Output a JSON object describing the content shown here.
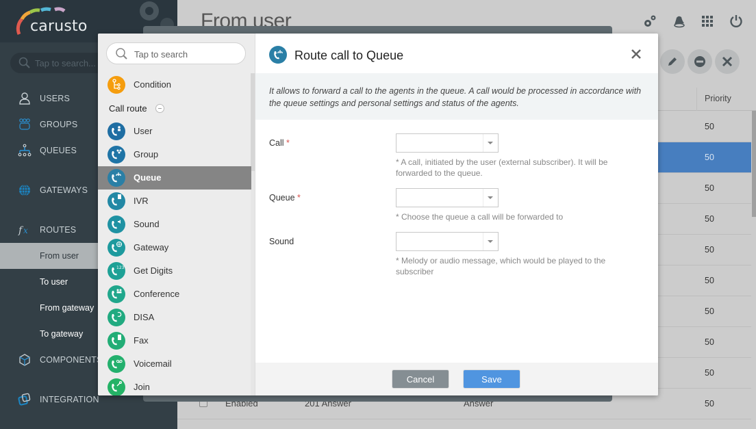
{
  "app": {
    "logo_text": "carusto"
  },
  "sidebar": {
    "search_placeholder": "Tap to search...",
    "items": [
      {
        "label": "USERS",
        "icon": "user-icon"
      },
      {
        "label": "GROUPS",
        "icon": "groups-icon"
      },
      {
        "label": "QUEUES",
        "icon": "queues-icon"
      },
      {
        "label": "GATEWAYS",
        "icon": "globe-icon"
      },
      {
        "label": "ROUTES",
        "icon": "fx-icon"
      },
      {
        "label": "COMPONENTS",
        "icon": "cube-icon"
      },
      {
        "label": "INTEGRATION",
        "icon": "integration-icon"
      }
    ],
    "route_subitems": [
      {
        "label": "From user",
        "active": true
      },
      {
        "label": "To user"
      },
      {
        "label": "From gateway"
      },
      {
        "label": "To gateway"
      }
    ]
  },
  "main": {
    "page_title": "From user",
    "top_icons": [
      "settings-icon",
      "bell-icon",
      "apps-grid-icon",
      "power-icon"
    ],
    "actions": [
      "edit-icon",
      "disable-icon",
      "delete-icon"
    ],
    "table": {
      "header_priority": "Priority",
      "rows": [
        {
          "priority": "50"
        },
        {
          "priority": "50",
          "selected": true
        },
        {
          "priority": "50"
        },
        {
          "priority": "50"
        },
        {
          "priority": "50"
        },
        {
          "priority": "50"
        },
        {
          "priority": "50"
        },
        {
          "priority": "50"
        },
        {
          "priority": "50"
        },
        {
          "priority": "50",
          "status": "Enabled",
          "code": "201 Answer",
          "action": "Answer"
        }
      ]
    }
  },
  "modal": {
    "search_placeholder": "Tap to search",
    "condition_label": "Condition",
    "section_label": "Call route",
    "components": [
      {
        "label": "User",
        "color": "#1f6ea3"
      },
      {
        "label": "Group",
        "color": "#1f74a6"
      },
      {
        "label": "Queue",
        "color": "#2a7fa6",
        "active": true
      },
      {
        "label": "IVR",
        "color": "#2288a5"
      },
      {
        "label": "Sound",
        "color": "#1f92a3"
      },
      {
        "label": "Gateway",
        "color": "#1d9a9e"
      },
      {
        "label": "Get Digits",
        "color": "#1ea196"
      },
      {
        "label": "Conference",
        "color": "#20a78c"
      },
      {
        "label": "DISA",
        "color": "#21aa80"
      },
      {
        "label": "Fax",
        "color": "#22ad76"
      },
      {
        "label": "Voicemail",
        "color": "#23b06d"
      },
      {
        "label": "Join",
        "color": "#24b266"
      }
    ],
    "title": "Route call to Queue",
    "description": "It allows to forward a call to the agents in the queue. A call would be processed in accordance with the queue settings and personal settings and status of the agents.",
    "fields": [
      {
        "label": "Call",
        "required": "*",
        "value": "",
        "hint": "* A call, initiated by the user (external subscriber). It will be forwarded to the queue."
      },
      {
        "label": "Queue",
        "required": "*",
        "value": "",
        "hint": "* Choose the queue a call will be forwarded to"
      },
      {
        "label": "Sound",
        "required": "",
        "value": "",
        "hint": "* Melody or audio message, which would be played to the subscriber"
      }
    ],
    "cancel_label": "Cancel",
    "save_label": "Save"
  },
  "colors": {
    "condition": "#f59d0e",
    "save": "#5095e0",
    "cancel": "#858e93",
    "selected_row": "#477ebf"
  }
}
